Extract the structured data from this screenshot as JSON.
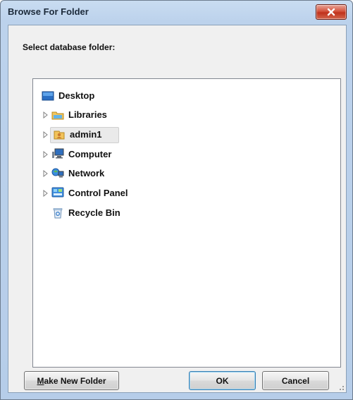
{
  "window": {
    "title": "Browse For Folder",
    "close_icon": "close-icon"
  },
  "prompt": "Select database folder:",
  "tree": {
    "items": [
      {
        "label": "Desktop",
        "icon": "desktop-icon",
        "expandable": false
      },
      {
        "label": "Libraries",
        "icon": "libraries-icon",
        "expandable": true
      },
      {
        "label": "admin1",
        "icon": "user-folder-icon",
        "expandable": true,
        "selected": true
      },
      {
        "label": "Computer",
        "icon": "computer-icon",
        "expandable": true
      },
      {
        "label": "Network",
        "icon": "network-icon",
        "expandable": true
      },
      {
        "label": "Control Panel",
        "icon": "control-panel-icon",
        "expandable": true
      },
      {
        "label": "Recycle Bin",
        "icon": "recycle-bin-icon",
        "expandable": false
      }
    ]
  },
  "buttons": {
    "make_new_folder_accel": "M",
    "make_new_folder_rest": "ake New Folder",
    "ok": "OK",
    "cancel": "Cancel"
  },
  "colors": {
    "frame": "#bcd2ec",
    "close_button": "#c0321c",
    "default_button_border": "#3c7fb1"
  }
}
